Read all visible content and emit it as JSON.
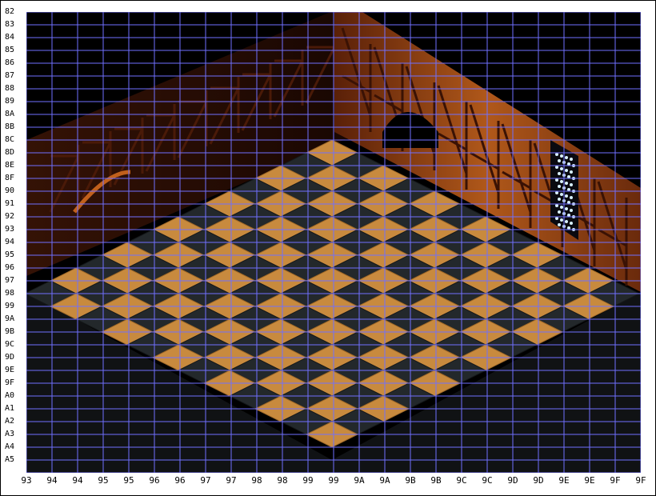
{
  "map_view": {
    "grid_color": "#7070ff",
    "background": "#000000",
    "row_labels": [
      "82",
      "83",
      "84",
      "85",
      "86",
      "87",
      "88",
      "89",
      "8A",
      "8B",
      "8C",
      "8D",
      "8E",
      "8F",
      "90",
      "91",
      "92",
      "93",
      "94",
      "95",
      "96",
      "97",
      "98",
      "99",
      "9A",
      "9B",
      "9C",
      "9D",
      "9E",
      "9F",
      "A0",
      "A1",
      "A2",
      "A3",
      "A4",
      "A5"
    ],
    "col_labels": [
      "93",
      "94",
      "94",
      "95",
      "95",
      "96",
      "96",
      "97",
      "97",
      "98",
      "98",
      "99",
      "99",
      "9A",
      "9A",
      "9B",
      "9B",
      "9C",
      "9C",
      "9D",
      "9D",
      "9E",
      "9E",
      "9F",
      "9F"
    ]
  },
  "scene": {
    "colors": {
      "wall_dark": "#2a0d04",
      "wall_mid": "#7a3010",
      "wall_light": "#c0601c",
      "tile_orange": "#c88a3e",
      "tile_dark": "#23282b",
      "floor_edge": "#3a3f44",
      "window_light": "#d8f0ff"
    },
    "icons": [
      "stained-glass-window-icon"
    ]
  }
}
